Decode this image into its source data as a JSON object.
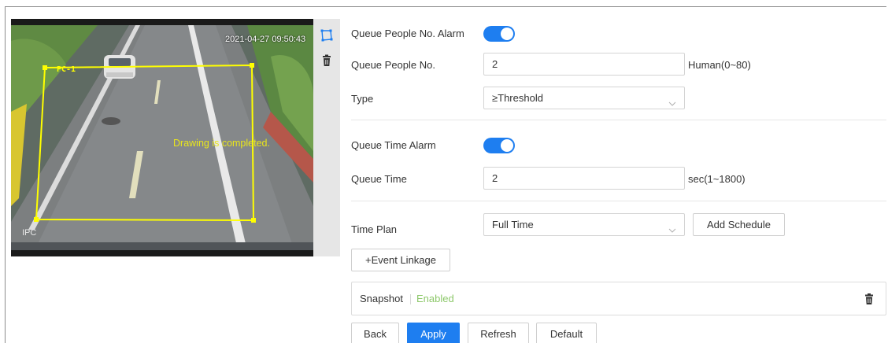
{
  "video": {
    "timestamp": "2021-04-27 09:50:43",
    "channel_label": "IPC",
    "region_label": "PC-1",
    "status_message": "Drawing is completed.",
    "tools": [
      "draw-region-icon",
      "delete-region-icon"
    ]
  },
  "queue_people": {
    "alarm_label": "Queue People No. Alarm",
    "alarm_enabled": true,
    "count_label": "Queue People No.",
    "count_value": "2",
    "count_unit": "Human(0~80)",
    "type_label": "Type",
    "type_value": "≥Threshold"
  },
  "queue_time": {
    "alarm_label": "Queue Time Alarm",
    "alarm_enabled": true,
    "time_label": "Queue Time",
    "time_value": "2",
    "time_unit": "sec(1~1800)"
  },
  "time_plan": {
    "label": "Time Plan",
    "value": "Full Time",
    "add_schedule_label": "Add Schedule"
  },
  "event_linkage": {
    "button_label": "+Event Linkage",
    "items": [
      {
        "name": "Snapshot",
        "status": "Enabled"
      }
    ]
  },
  "footer": {
    "back_label": "Back",
    "apply_label": "Apply",
    "refresh_label": "Refresh",
    "default_label": "Default"
  },
  "colors": {
    "accent": "#1e7ef0",
    "enabled_text": "#8dc86a",
    "region_outline": "#ffff00"
  }
}
